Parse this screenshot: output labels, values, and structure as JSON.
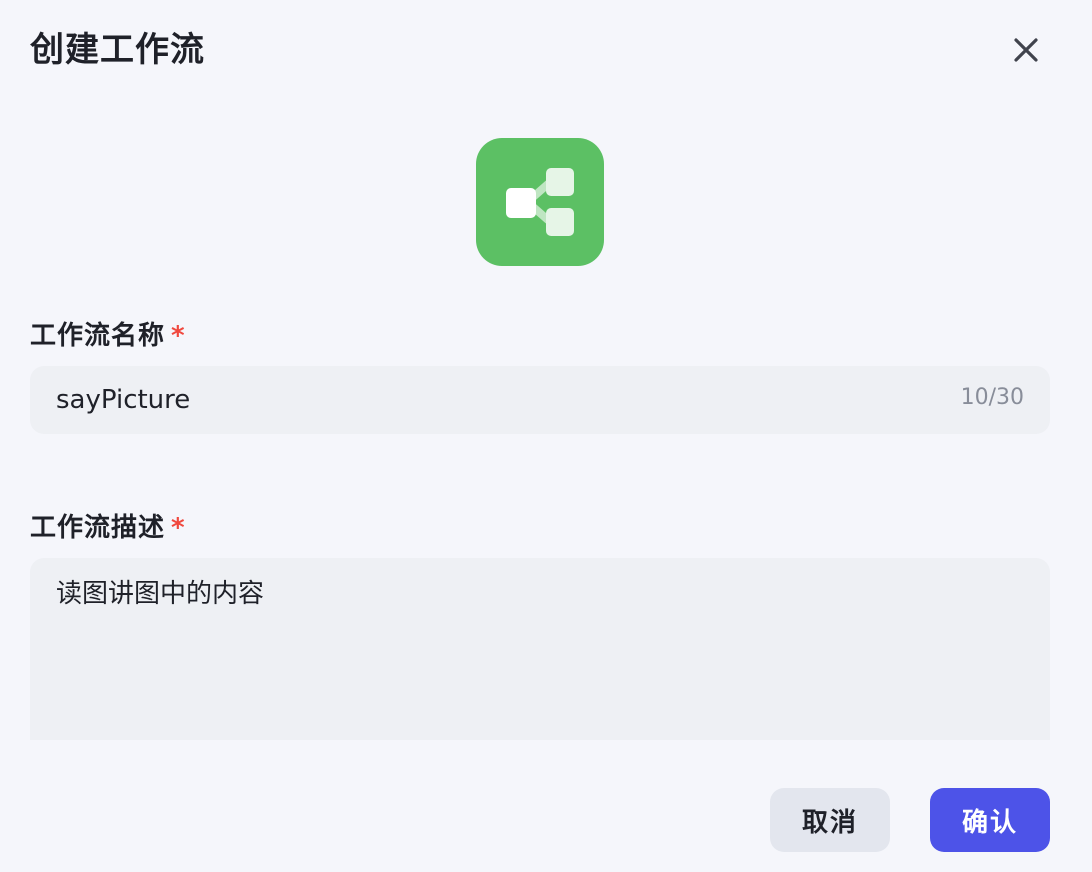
{
  "dialog": {
    "title": "创建工作流",
    "close_icon": "close-icon",
    "app_icon": {
      "name": "workflow-node-icon",
      "bg_color": "#5cc064"
    }
  },
  "form": {
    "name_label": "工作流名称",
    "name_required_mark": "*",
    "name_value": "sayPicture",
    "name_counter": "10/30",
    "desc_label": "工作流描述",
    "desc_required_mark": "*",
    "desc_value": "读图讲图中的内容"
  },
  "footer": {
    "cancel_label": "取消",
    "confirm_label": "确认"
  },
  "colors": {
    "background": "#f5f6fb",
    "input_bg": "#eef0f4",
    "required": "#f0483e",
    "primary": "#4d53e8",
    "secondary_btn": "#e3e6ee"
  }
}
